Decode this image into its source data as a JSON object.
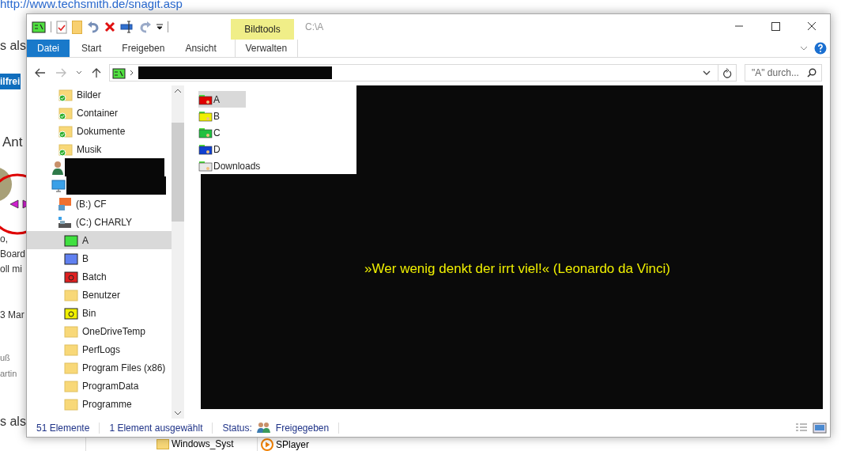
{
  "background_page": {
    "link": "http://www.techsmith.de/snagit.asp",
    "fragments": [
      {
        "kind": "heading",
        "text": "s als"
      },
      {
        "kind": "button",
        "text": "ilfrei"
      },
      {
        "kind": "title",
        "text": "Ant"
      },
      {
        "kind": "body",
        "text": "o,"
      },
      {
        "kind": "body",
        "text": "Board"
      },
      {
        "kind": "body",
        "text": "oll mi"
      },
      {
        "kind": "date",
        "text": "3 Mar"
      },
      {
        "kind": "small",
        "text": "uß"
      },
      {
        "kind": "small",
        "text": "artin"
      },
      {
        "kind": "heading2",
        "text": "s als"
      }
    ],
    "below_items": [
      {
        "kind": "folder",
        "text": "Windows_Syst"
      },
      {
        "kind": "player",
        "text": "SPlayer"
      }
    ]
  },
  "window": {
    "title": "C:\\A",
    "context_tab": "Bildtools",
    "tabs": [
      {
        "label": "Datei",
        "selected": false,
        "kind": "file"
      },
      {
        "label": "Start",
        "selected": false,
        "kind": "tab"
      },
      {
        "label": "Freigeben",
        "selected": false,
        "kind": "tab"
      },
      {
        "label": "Ansicht",
        "selected": false,
        "kind": "tab"
      },
      {
        "label": "Verwalten",
        "selected": false,
        "kind": "context"
      }
    ],
    "address": {
      "redacted": true
    },
    "search": {
      "placeholder": "\"A\" durch..."
    },
    "nav_tree": [
      {
        "kind": "synced",
        "label": "Bilder",
        "selected": false
      },
      {
        "kind": "synced",
        "label": "Container",
        "selected": false
      },
      {
        "kind": "synced",
        "label": "Dokumente",
        "selected": false
      },
      {
        "kind": "synced",
        "label": "Musik",
        "selected": false
      },
      {
        "kind": "user",
        "redacted": true,
        "selected": false
      },
      {
        "kind": "computer",
        "redacted": true,
        "selected": false,
        "children": [
          {
            "kind": "drive-cf",
            "label": "(B:) CF",
            "selected": false
          },
          {
            "kind": "drive",
            "label": "(C:) CHARLY",
            "selected": false,
            "children": [
              {
                "kind": "green-folder",
                "label": "A",
                "selected": true
              },
              {
                "kind": "blue-folder",
                "label": "B",
                "selected": false
              },
              {
                "kind": "red-folder",
                "label": "Batch",
                "selected": false
              },
              {
                "kind": "folder",
                "label": "Benutzer",
                "selected": false
              },
              {
                "kind": "yellow-folder",
                "label": "Bin",
                "selected": false
              },
              {
                "kind": "folder",
                "label": "OneDriveTemp",
                "selected": false
              },
              {
                "kind": "folder",
                "label": "PerfLogs",
                "selected": false
              },
              {
                "kind": "folder",
                "label": "Program Files (x86)",
                "selected": false
              },
              {
                "kind": "folder",
                "label": "ProgramData",
                "selected": false
              },
              {
                "kind": "folder",
                "label": "Programme",
                "selected": false
              }
            ]
          }
        ]
      }
    ],
    "files": [
      {
        "name": "A",
        "color": "#e00000",
        "selected": true
      },
      {
        "name": "B",
        "color": "#f0f000",
        "selected": false
      },
      {
        "name": "C",
        "color": "#20c040",
        "selected": false
      },
      {
        "name": "D",
        "color": "#1040d0",
        "selected": false
      },
      {
        "name": "Downloads",
        "color": "#e8e8e8",
        "selected": false
      }
    ],
    "preview_quote": "»Wer wenig denkt der irrt viel!« (Leonardo da Vinci)",
    "status_bar": {
      "count": "51 Elemente",
      "selection": "1 Element ausgewählt",
      "status_label": "Status:",
      "status": "Freigegeben"
    }
  }
}
